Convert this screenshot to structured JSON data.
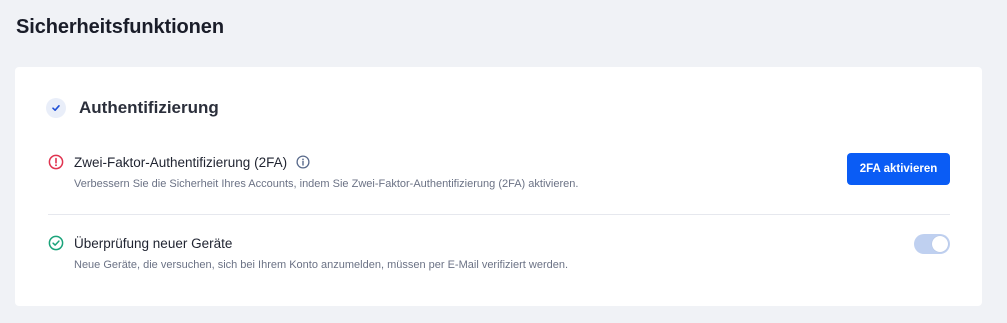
{
  "page": {
    "title": "Sicherheitsfunktionen"
  },
  "section": {
    "title": "Authentifizierung",
    "icon": "check-icon"
  },
  "features": [
    {
      "title": "Zwei-Faktor-Authentifizierung (2FA)",
      "description": "Verbessern Sie die Sicherheit Ihres Accounts, indem Sie Zwei-Faktor-Authentifizierung (2FA) aktivieren.",
      "status_icon": "alert-circle-icon",
      "status": "inactive",
      "info_icon": "info-icon",
      "action_label": "2FA aktivieren"
    },
    {
      "title": "Überprüfung neuer Geräte",
      "description": "Neue Geräte, die versuchen, sich bei Ihrem Konto anzumelden, müssen per E-Mail verifiziert werden.",
      "status_icon": "check-circle-icon",
      "status": "active",
      "toggle_on": true
    }
  ],
  "colors": {
    "background": "#f0f2f6",
    "card": "#ffffff",
    "primary": "#0a5cf5",
    "danger": "#e0334f",
    "success": "#1aa37a",
    "toggle_track": "#bfd0f0"
  }
}
